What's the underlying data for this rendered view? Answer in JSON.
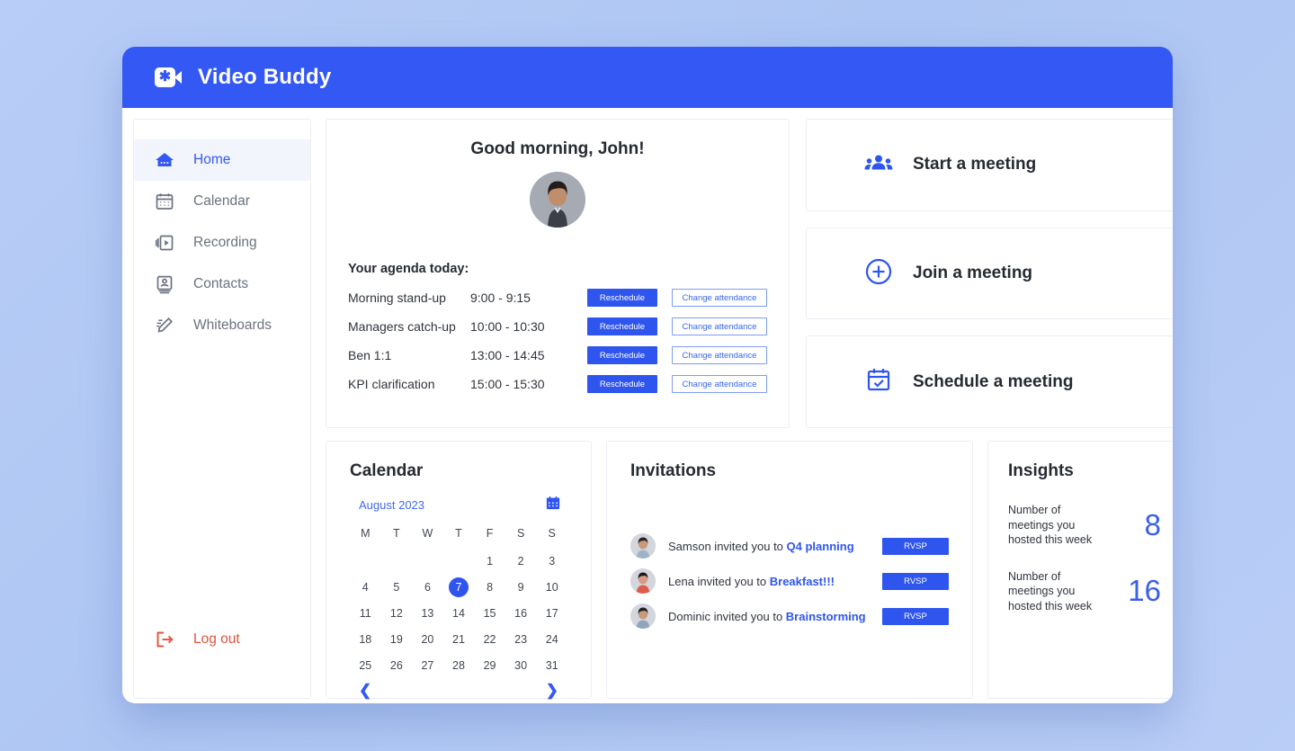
{
  "header": {
    "title": "Video Buddy",
    "logo_icon": "video-camera-icon"
  },
  "sidebar": {
    "items": [
      {
        "label": "Home",
        "icon": "home-icon",
        "active": true
      },
      {
        "label": "Calendar",
        "icon": "calendar-icon",
        "active": false
      },
      {
        "label": "Recording",
        "icon": "recording-icon",
        "active": false
      },
      {
        "label": "Contacts",
        "icon": "contacts-icon",
        "active": false
      },
      {
        "label": "Whiteboards",
        "icon": "whiteboard-pencil-icon",
        "active": false
      }
    ],
    "logout": {
      "label": "Log out",
      "icon": "logout-arrow-icon",
      "color": "#e2553d"
    }
  },
  "greeting": {
    "title": "Good morning, John!",
    "avatar": "user-avatar",
    "agenda_title": "Your agenda today:",
    "agenda": [
      {
        "name": "Morning stand-up",
        "time": "9:00 - 9:15",
        "reschedule": "Reschedule",
        "change": "Change attendance"
      },
      {
        "name": "Managers catch-up",
        "time": "10:00 - 10:30",
        "reschedule": "Reschedule",
        "change": "Change attendance"
      },
      {
        "name": "Ben 1:1",
        "time": "13:00 - 14:45",
        "reschedule": "Reschedule",
        "change": "Change attendance"
      },
      {
        "name": "KPI clarification",
        "time": "15:00 - 15:30",
        "reschedule": "Reschedule",
        "change": "Change attendance"
      }
    ]
  },
  "actions": [
    {
      "label": "Start a meeting",
      "icon": "people-group-icon"
    },
    {
      "label": "Join a meeting",
      "icon": "plus-circle-icon"
    },
    {
      "label": "Schedule a meeting",
      "icon": "calendar-check-icon"
    }
  ],
  "calendar": {
    "title": "Calendar",
    "month": "August 2023",
    "picker_icon": "calendar-picker-icon",
    "dow": [
      "M",
      "T",
      "W",
      "T",
      "F",
      "S",
      "S"
    ],
    "leading_blanks": 4,
    "days": [
      1,
      2,
      3,
      4,
      5,
      6,
      7,
      8,
      9,
      10,
      11,
      12,
      13,
      14,
      15,
      16,
      17,
      18,
      19,
      20,
      21,
      22,
      23,
      24,
      25,
      26,
      27,
      28,
      29,
      30,
      31
    ],
    "today": 7,
    "prev_icon": "chevron-left-icon",
    "next_icon": "chevron-right-icon"
  },
  "invitations": {
    "title": "Invitations",
    "items": [
      {
        "prefix": "Samson invited you to ",
        "event": "Q4 planning",
        "button": "RVSP",
        "avatar": "inviter-avatar"
      },
      {
        "prefix": "Lena invited you to ",
        "event": "Breakfast!!!",
        "button": "RVSP",
        "avatar": "inviter-avatar"
      },
      {
        "prefix": "Dominic invited you to ",
        "event": "Brainstorming",
        "button": "RVSP",
        "avatar": "inviter-avatar"
      }
    ]
  },
  "insights": {
    "title": "Insights",
    "stats": [
      {
        "label": "Number of meetings you hosted this week",
        "value": "8"
      },
      {
        "label": "Number of meetings you hosted this week",
        "value": "16"
      }
    ]
  },
  "colors": {
    "brand_blue": "#3358f4",
    "button_blue": "#2f55ef",
    "link_blue": "#3f6bf0",
    "logout_red": "#e2553d",
    "page_bg": "#aec6f3"
  }
}
